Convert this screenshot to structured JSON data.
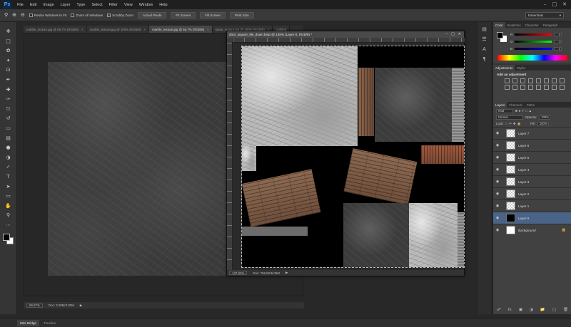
{
  "menu": {
    "logo": "Ps",
    "items": [
      "File",
      "Edit",
      "Image",
      "Layer",
      "Type",
      "Select",
      "Filter",
      "View",
      "Window",
      "Help"
    ]
  },
  "options": {
    "resize_windows": "Resize Windows to Fit",
    "zoom_all": "Zoom All Windows",
    "scrubby_zoom": "Scrubby Zoom",
    "actual_pixels": "Actual Pixels",
    "fit_screen": "Fit Screen",
    "fill_screen": "Fill Screen",
    "print_size": "Print Size",
    "workspace": "Essentials"
  },
  "tabs": [
    "marble_texture.jpg @ 66.7% (RGB/8)",
    "marble_texture.jpg @ 100% (RGB/8)",
    "marble_texture.jpg @ 66.7% (RGB/8)",
    "stone_texture.jpg @ 100% (RGB/8)",
    "Untitled"
  ],
  "doc1": {
    "zoom": "66.67%",
    "doc_size": "Doc: 3.00M/3.00M"
  },
  "doc2": {
    "title": "door_square_tile_down.bmp @ 138% (Layer 8, RGB/8) *",
    "zoom": "137.92%",
    "doc_size": "Doc: 768.0K/5.06M"
  },
  "panels": {
    "color_tabs": [
      "Color",
      "Swatches",
      "Character",
      "Paragraph"
    ],
    "rgb_labels": [
      "R",
      "G",
      "B"
    ],
    "rgb_values": [
      "0",
      "0",
      "0"
    ],
    "adj_tabs": [
      "Adjustments",
      "Styles"
    ],
    "adj_title": "Add an adjustment",
    "layer_tabs": [
      "Layers",
      "Channels",
      "Paths"
    ],
    "kind": "Kind",
    "blend_mode": "Normal",
    "opacity_label": "Opacity:",
    "opacity": "100%",
    "lock_label": "Lock:",
    "fill_label": "Fill:",
    "fill": "100%",
    "layers": [
      "Layer 7",
      "Layer 6",
      "Layer 5",
      "Layer 4",
      "Layer 3",
      "Layer 2",
      "Layer 1",
      "Layer 8",
      "Background"
    ],
    "selected_layer": "Layer 8"
  },
  "bottom": {
    "tabs": [
      "Mini Bridge",
      "Timeline"
    ]
  }
}
